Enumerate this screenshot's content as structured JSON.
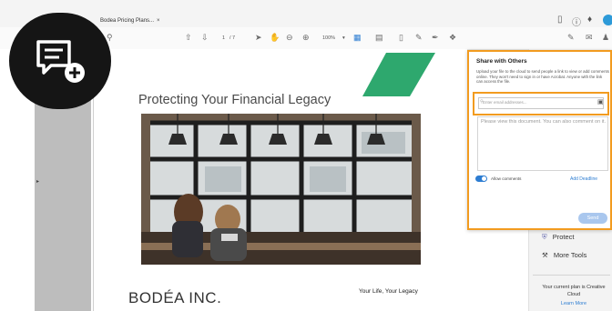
{
  "tab": {
    "title": "Bodea Pricing Plans...",
    "close": "×"
  },
  "toolbar": {
    "page_current": "1",
    "page_total": "/ 7",
    "zoom": "100%"
  },
  "document": {
    "title": "Protecting Your Financial Legacy",
    "brand": "BODÉA INC.",
    "tagline": "Your Life, Your Legacy"
  },
  "share": {
    "title": "Share with Others",
    "description": "Upload your file to the cloud to send people a link to view or add comments online. They won't need to sign in or have Acrobat. Anyone with the link can access the file.",
    "email_placeholder": "Enter email addresses...",
    "message_placeholder": "Please view this document. You can also comment on it.",
    "allow_comments": "Allow comments",
    "allow_comments_on": true,
    "add_deadline": "Add Deadline",
    "send": "Send"
  },
  "tools": {
    "protect": "Protect",
    "more_tools": "More Tools",
    "plan_text": "Your current plan is Creative Cloud",
    "learn_more": "Learn More"
  },
  "colors": {
    "highlight": "#f29b1f",
    "accent": "#2d7dd2",
    "brand_green": "#2ea86e"
  }
}
